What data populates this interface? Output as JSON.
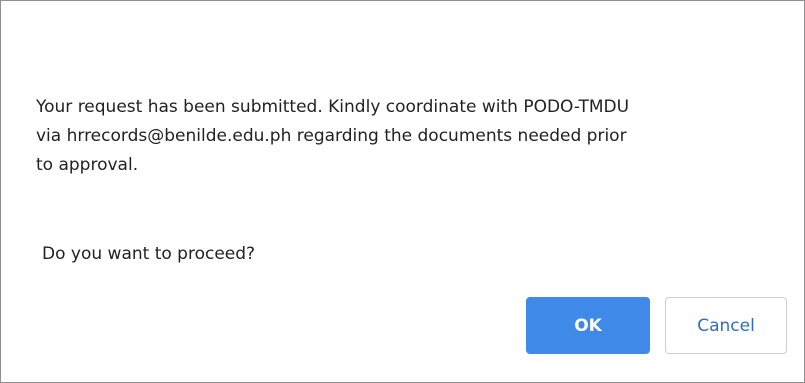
{
  "dialog": {
    "message_line1": "Your request has been submitted. Kindly coordinate with PODO-TMDU",
    "message_line2": "via hrrecords@benilde.edu.ph regarding the documents needed prior",
    "message_line3": "to approval.",
    "question": "Do you want to proceed?",
    "ok_label": "OK",
    "cancel_label": "Cancel"
  },
  "colors": {
    "ok_button": "#3f8ae8",
    "cancel_text": "#2d6fc2",
    "border": "#8f8f8f"
  }
}
